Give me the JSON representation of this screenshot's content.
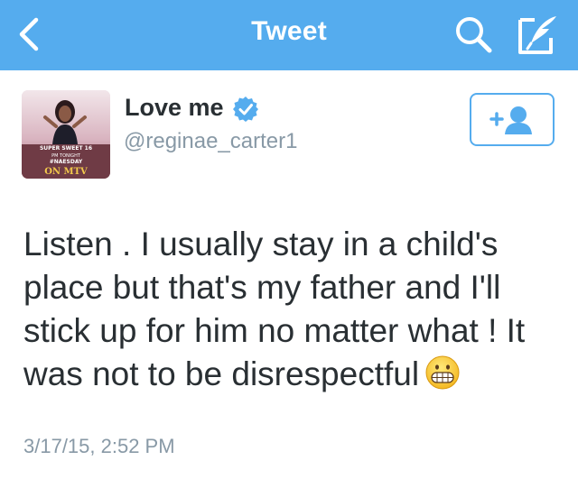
{
  "navbar": {
    "title": "Tweet",
    "background_color": "#55acee",
    "icons": [
      "back-chevron-icon",
      "search-icon",
      "compose-icon"
    ]
  },
  "author": {
    "display_name": "Love me",
    "handle": "@reginae_carter1",
    "verified": true,
    "verified_badge_color": "#55acee",
    "avatar_icon": "profile-photo",
    "avatar_text": [
      "SUPER SWEET 16",
      "PM TONIGHT",
      "#NAESDAY",
      "ON MTV"
    ]
  },
  "follow_button": {
    "icon": "add-user-icon",
    "accent_color": "#55acee"
  },
  "tweet": {
    "text_before_emoji": "Listen . I usually stay in a child's place but that's my father and I'll stick up for him no matter what ! It was not to be disrespectful",
    "emoji_icon": "grimacing-face-emoji",
    "timestamp": "3/17/15, 2:52 PM"
  }
}
